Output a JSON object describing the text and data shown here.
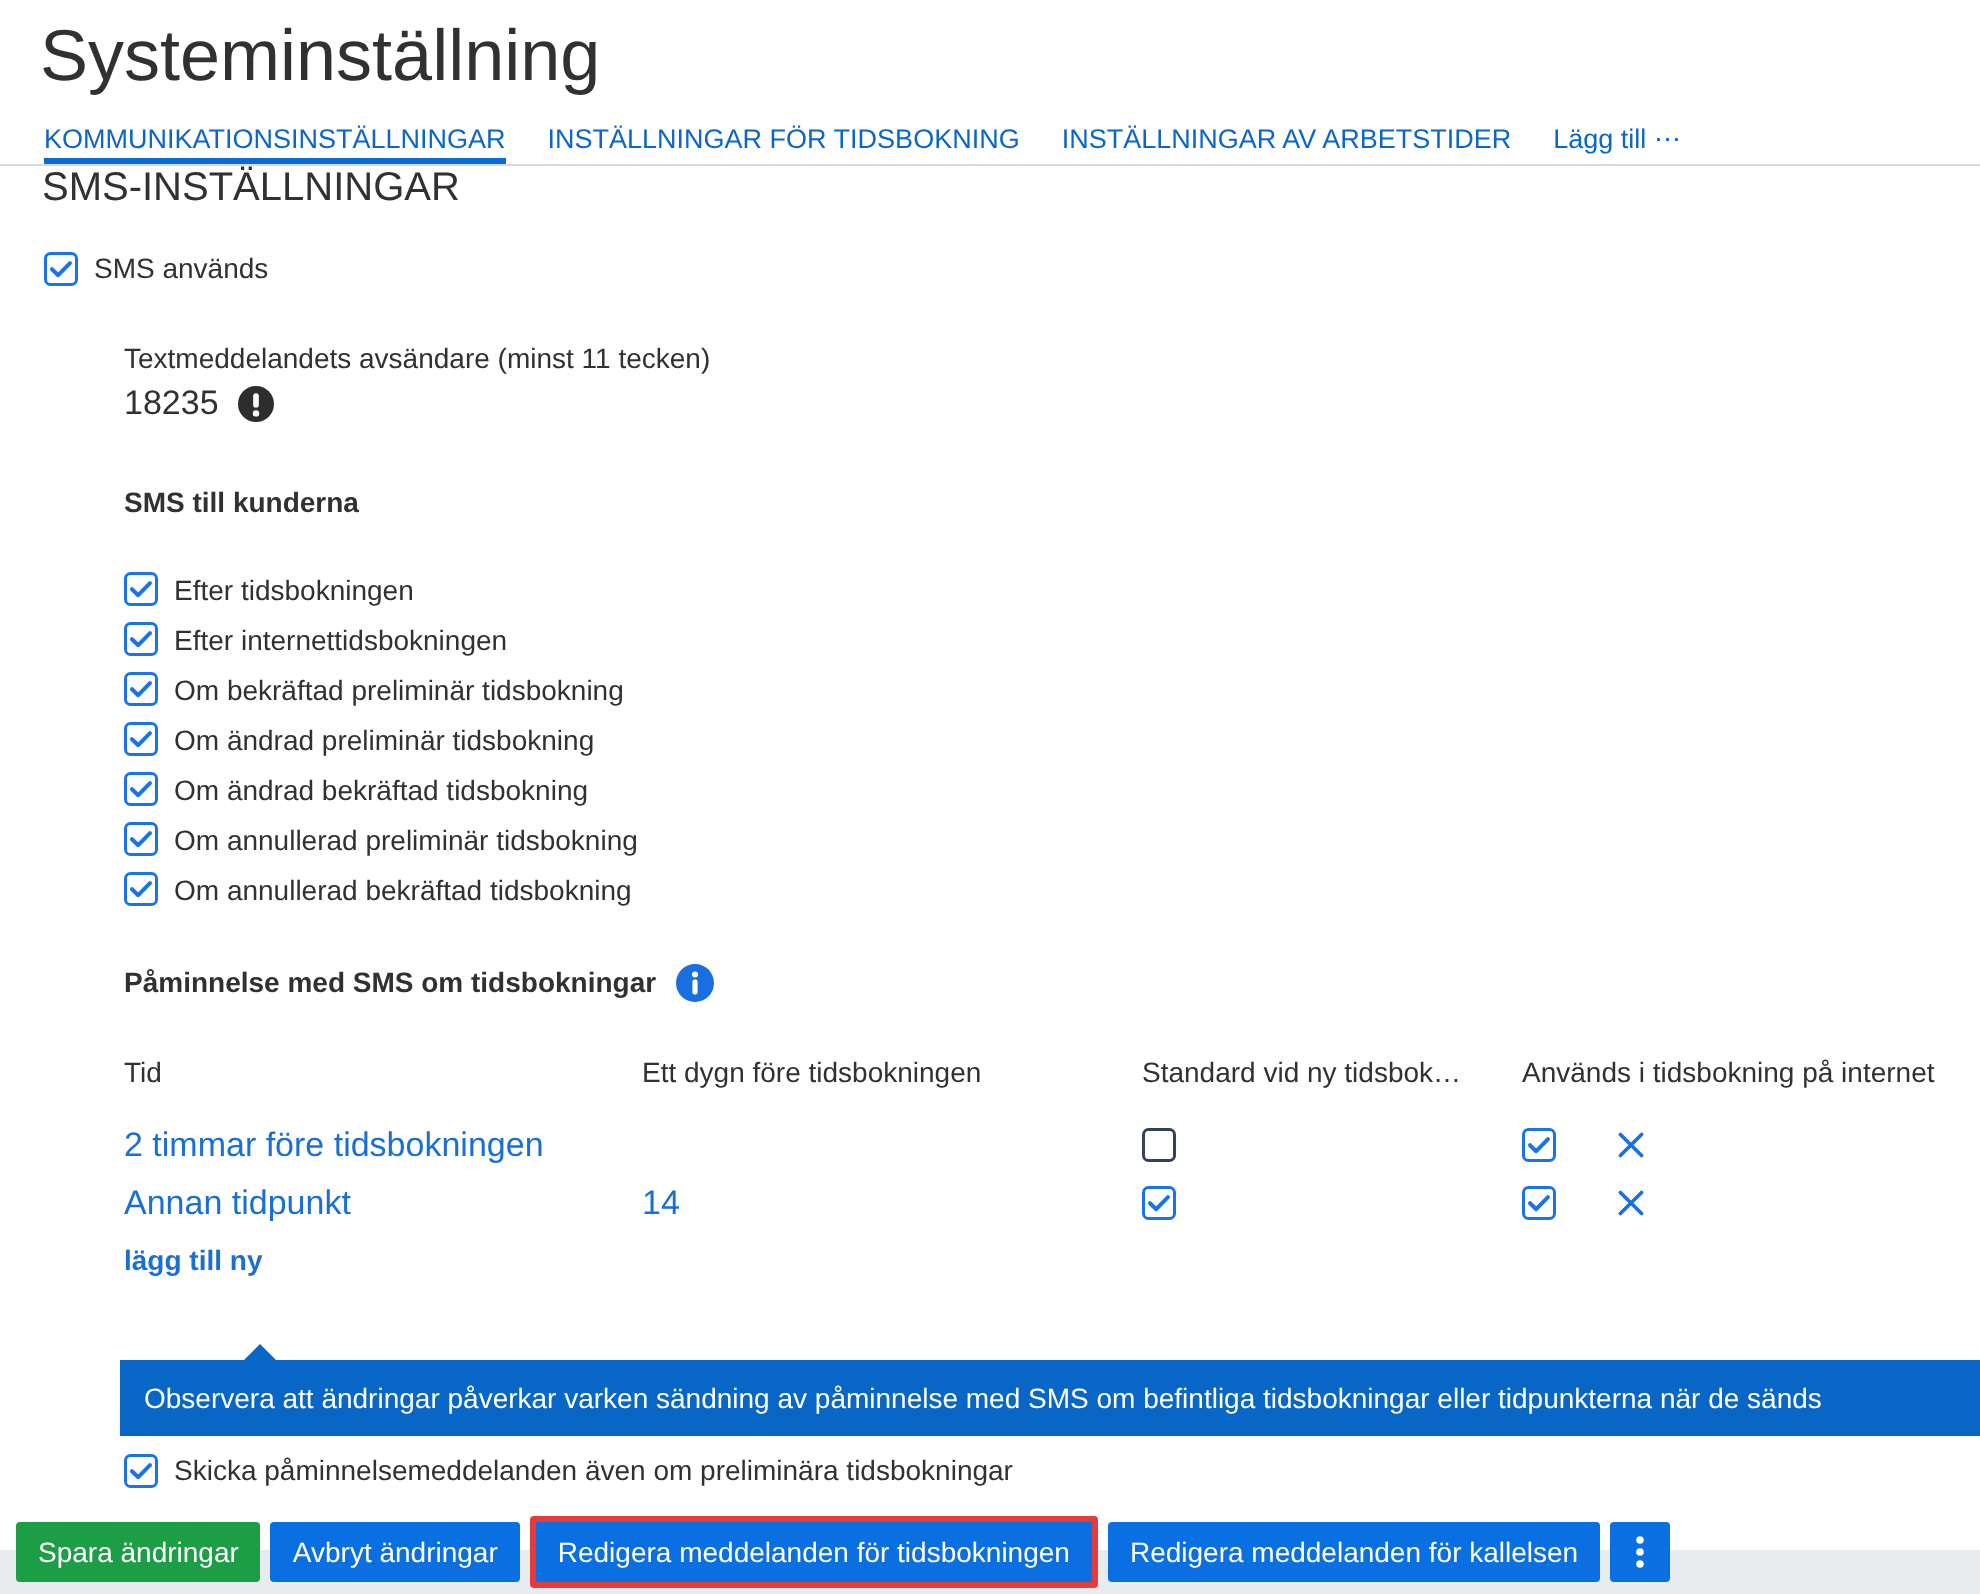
{
  "page": {
    "title": "Systeminställning"
  },
  "tabs": [
    {
      "label": "KOMMUNIKATIONSINSTÄLLNINGAR",
      "selected": true
    },
    {
      "label": "INSTÄLLNINGAR FÖR TIDSBOKNING",
      "selected": false
    },
    {
      "label": "INSTÄLLNINGAR AV ARBETSTIDER",
      "selected": false
    },
    {
      "label": "Lägg till ⋯",
      "selected": false
    }
  ],
  "sms_settings": {
    "heading": "SMS-INSTÄLLNINGAR",
    "sms_used": {
      "label": "SMS används",
      "checked": true
    },
    "sender": {
      "label": "Textmeddelandets avsändare (minst 11 tecken)",
      "value": "18235"
    },
    "customer_sms": {
      "heading": "SMS till kunderna",
      "options": [
        {
          "label": "Efter tidsbokningen",
          "checked": true
        },
        {
          "label": "Efter internettidsbokningen",
          "checked": true
        },
        {
          "label": "Om bekräftad preliminär tidsbokning",
          "checked": true
        },
        {
          "label": "Om ändrad preliminär tidsbokning",
          "checked": true
        },
        {
          "label": "Om ändrad bekräftad tidsbokning",
          "checked": true
        },
        {
          "label": "Om annullerad preliminär tidsbokning",
          "checked": true
        },
        {
          "label": "Om annullerad bekräftad tidsbokning",
          "checked": true
        }
      ]
    },
    "reminders": {
      "heading": "Påminnelse med SMS om tidsbokningar",
      "columns": [
        "Tid",
        "Ett dygn före tidsbokningen",
        "Standard vid ny tidsbok…",
        "Används i tidsbokning på internet"
      ],
      "rows": [
        {
          "time": "2 timmar före tidsbokningen",
          "default_checked": false,
          "internet_checked": true
        },
        {
          "time": "Annan tidpunkt",
          "column_2": "14",
          "default_checked": true,
          "internet_checked": true
        }
      ],
      "add_link": "lägg till ny",
      "notice": "Observera att ändringar påverkar varken sändning av påminnelse med SMS om befintliga tidsbokningar eller tidpunkterna när de sänds",
      "send_preliminary": {
        "label": "Skicka påminnelsemeddelanden även om preliminära tidsbokningar",
        "checked": true
      }
    }
  },
  "buttons": [
    {
      "label": "Spara ändringar",
      "kind": "success",
      "outlined": false
    },
    {
      "label": "Avbryt ändringar",
      "kind": "primary",
      "outlined": false
    },
    {
      "label": "Redigera meddelanden för tidsbokningen",
      "kind": "primary",
      "outlined": true
    },
    {
      "label": "Redigera meddelanden för kallelsen",
      "kind": "primary",
      "outlined": false
    },
    {
      "kind": "more",
      "outlined": false
    }
  ]
}
